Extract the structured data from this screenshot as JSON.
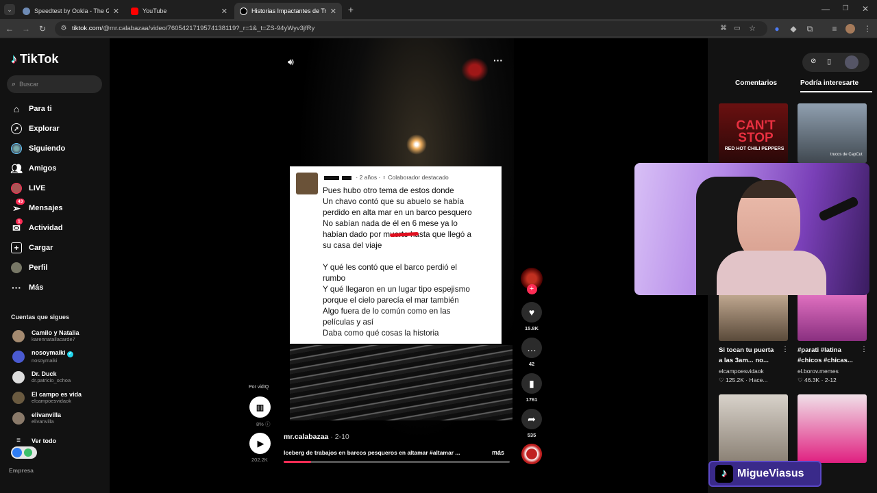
{
  "browser": {
    "tabs": [
      {
        "title": "Speedtest by Ookla - The Global",
        "color": "#6e8bb5"
      },
      {
        "title": "YouTube",
        "color": "#ff0000"
      },
      {
        "title": "Historias Impactantes de Trabajo",
        "color": "#ffffff"
      }
    ],
    "new_tab_icon": "plus-icon",
    "url_host": "tiktok.com",
    "url_path": "/@mr.calabazaa/video/7605421719574138119?_r=1&_t=ZS-94yWyv3jfRy"
  },
  "sidebar": {
    "logo": "TikTok",
    "search_placeholder": "Buscar",
    "nav": [
      {
        "label": "Para ti",
        "icon": "home-icon"
      },
      {
        "label": "Explorar",
        "icon": "compass-icon"
      },
      {
        "label": "Siguiendo",
        "icon": "following-avatar-icon"
      },
      {
        "label": "Amigos",
        "icon": "friends-icon"
      },
      {
        "label": "LIVE",
        "icon": "live-icon"
      },
      {
        "label": "Mensajes",
        "icon": "paper-plane-icon",
        "badge": "43"
      },
      {
        "label": "Actividad",
        "icon": "inbox-icon",
        "badge": "1"
      },
      {
        "label": "Cargar",
        "icon": "upload-plus-icon"
      },
      {
        "label": "Perfil",
        "icon": "profile-avatar-icon"
      },
      {
        "label": "Más",
        "icon": "more-dots-icon"
      }
    ],
    "following_title": "Cuentas que sigues",
    "following": [
      {
        "name": "Camilo y Natalia",
        "handle": "karennatallacarde7"
      },
      {
        "name": "nosoymaiki",
        "handle": "nosoymaiki",
        "verified": true
      },
      {
        "name": "Dr. Duck",
        "handle": "dr.patricio_ochoa"
      },
      {
        "name": "El campo es vida",
        "handle": "elcampoesvidaok"
      },
      {
        "name": "elivanvilla",
        "handle": "elivanvilla"
      }
    ],
    "see_all": "Ver todo",
    "company": "Empresa"
  },
  "video": {
    "post_time": "2 años",
    "post_badge": "Colaborador destacado",
    "post_text": "Pues hubo otro tema de estos donde\nUn chavo contó que su abuelo se había\nperdido en alta mar en un barco pesquero\nNo sabían nada de él en 6 mese ya lo\nhabían dado por muerto hasta que llegó a\nsu casa del viaje\n\nY qué les contó que el barco perdió  el\nrumbo\nY qué llegaron en un lugar tipo espejismo\nporque el cielo parecía el mar también\nAlgo fuera de lo común como en las\npelículas y así\nDaba como qué cosas la historia",
    "creator": "mr.calabazaa",
    "date": "2-10",
    "caption": "Iceberg de trabajos en barcos pesqueros en altamar #altamar ...",
    "more": "más",
    "progress": 0.12,
    "likes": "15.8K",
    "comments": "42",
    "saves": "1761",
    "shares": "535",
    "vidiq_label": "Por vidIQ",
    "vidiq_percent": "8%",
    "views": "202.2K"
  },
  "right_panel": {
    "tab_comments": "Comentarios",
    "tab_interest": "Podría interesarte",
    "recommendations": [
      {
        "title": "",
        "user": "",
        "stats": ""
      },
      {
        "title": "",
        "user": "",
        "stats": ""
      },
      {
        "title": "Si tocan tu puerta a las 3am... no...",
        "user": "elcampoesvidaok",
        "stats": "125.2K · Hace..."
      },
      {
        "title": "#parati #latina #chicos #chicas...",
        "user": "el.borov.memes",
        "stats": "46.3K · 2-12"
      }
    ],
    "thumb1_text": "CAN'T STOP",
    "thumb1_sub": "RED HOT CHILI PEPPERS",
    "thumb2_sub": "trucos de CapCut"
  },
  "streamer": "MigueViasus",
  "colors": {
    "accent": "#fe2c55",
    "background": "#121212",
    "tab_active": "#353535"
  }
}
